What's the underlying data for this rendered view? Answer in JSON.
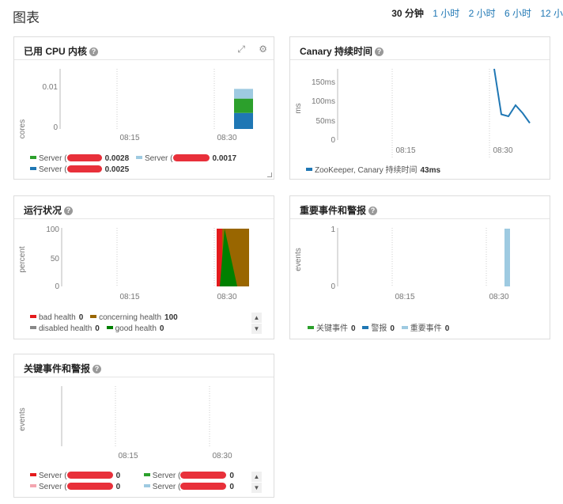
{
  "page": {
    "title": "图表",
    "time_ranges": [
      "30 分钟",
      "1 小时",
      "2 小时",
      "6 小时",
      "12 小"
    ],
    "active_range": 0
  },
  "cards": {
    "cpu": {
      "title": "已用 CPU 内核",
      "icons": [
        "expand-icon",
        "gear-icon"
      ],
      "legend": [
        {
          "label": "Server (",
          "value": "0.0028",
          "color": "#2ca02c"
        },
        {
          "label": "Server (",
          "value": "0.0017",
          "color": "#9ecae1"
        },
        {
          "label": "Server (",
          "value": "0.0025",
          "color": "#1f77b4"
        }
      ]
    },
    "canary": {
      "title": "Canary 持续时间",
      "legend": [
        {
          "label": "ZooKeeper, Canary 持续时间",
          "value": "43ms",
          "color": "#1f77b4"
        }
      ]
    },
    "health": {
      "title": "运行状况",
      "legend": [
        {
          "label": "bad health",
          "value": "0",
          "color": "#e41a1c"
        },
        {
          "label": "concerning health",
          "value": "100",
          "color": "#996600"
        },
        {
          "label": "disabled health",
          "value": "0",
          "color": "#888888"
        },
        {
          "label": "good health",
          "value": "0",
          "color": "#008000"
        }
      ]
    },
    "important": {
      "title": "重要事件和警报",
      "legend": [
        {
          "label": "关键事件",
          "value": "0",
          "color": "#2ca02c"
        },
        {
          "label": "警报",
          "value": "0",
          "color": "#1f77b4"
        },
        {
          "label": "重要事件",
          "value": "0",
          "color": "#9ecae1"
        }
      ]
    },
    "critical": {
      "title": "关键事件和警报",
      "legend": [
        {
          "label": "Server (",
          "value": "0",
          "color": "#e41a1c"
        },
        {
          "label": "Server (",
          "value": "0",
          "color": "#2ca02c"
        },
        {
          "label": "Server (",
          "value": "0",
          "color": "#f4a6b0"
        },
        {
          "label": "Server (",
          "value": "0",
          "color": "#9ecae1"
        }
      ]
    }
  },
  "chart_data": [
    {
      "type": "area",
      "title": "已用 CPU 内核",
      "ylabel": "cores",
      "x_ticks": [
        "08:15",
        "08:30"
      ],
      "y_ticks": [
        "0",
        "0.01"
      ],
      "ylim": [
        0,
        0.0105
      ],
      "series": [
        {
          "values": [
            0.0028
          ],
          "color": "#1f77b4"
        },
        {
          "values": [
            0.0025
          ],
          "color": "#2ca02c"
        },
        {
          "values": [
            0.0017
          ],
          "color": "#9ecae1"
        }
      ]
    },
    {
      "type": "line",
      "title": "Canary 持续时间",
      "ylabel": "ms",
      "x_ticks": [
        "08:15",
        "08:30"
      ],
      "y_ticks": [
        "0",
        "50ms",
        "100ms",
        "150ms"
      ],
      "ylim": [
        0,
        180
      ],
      "x": [
        "08:31",
        "08:32",
        "08:33",
        "08:34",
        "08:35",
        "08:36"
      ],
      "series": [
        {
          "name": "ZooKeeper, Canary 持续时间",
          "values": [
            180,
            65,
            60,
            88,
            68,
            43
          ],
          "color": "#1f77b4"
        }
      ]
    },
    {
      "type": "area",
      "title": "运行状况",
      "ylabel": "percent",
      "x_ticks": [
        "08:15",
        "08:30"
      ],
      "y_ticks": [
        "0",
        "50",
        "100"
      ],
      "ylim": [
        0,
        100
      ],
      "series": [
        {
          "name": "bad health",
          "values": [
            100,
            0,
            0
          ],
          "color": "#e41a1c"
        },
        {
          "name": "concerning health",
          "values": [
            0,
            50,
            100
          ],
          "color": "#996600"
        },
        {
          "name": "good health",
          "values": [
            0,
            100,
            0
          ],
          "color": "#008000"
        }
      ]
    },
    {
      "type": "bar",
      "title": "重要事件和警报",
      "ylabel": "events",
      "x_ticks": [
        "08:15",
        "08:30"
      ],
      "y_ticks": [
        "0",
        "1"
      ],
      "ylim": [
        0,
        1
      ],
      "series": [
        {
          "name": "重要事件",
          "values": [
            1
          ],
          "color": "#9ecae1"
        }
      ]
    },
    {
      "type": "line",
      "title": "关键事件和警报",
      "ylabel": "events",
      "x_ticks": [
        "08:15",
        "08:30"
      ],
      "y_ticks": [],
      "series": []
    }
  ]
}
